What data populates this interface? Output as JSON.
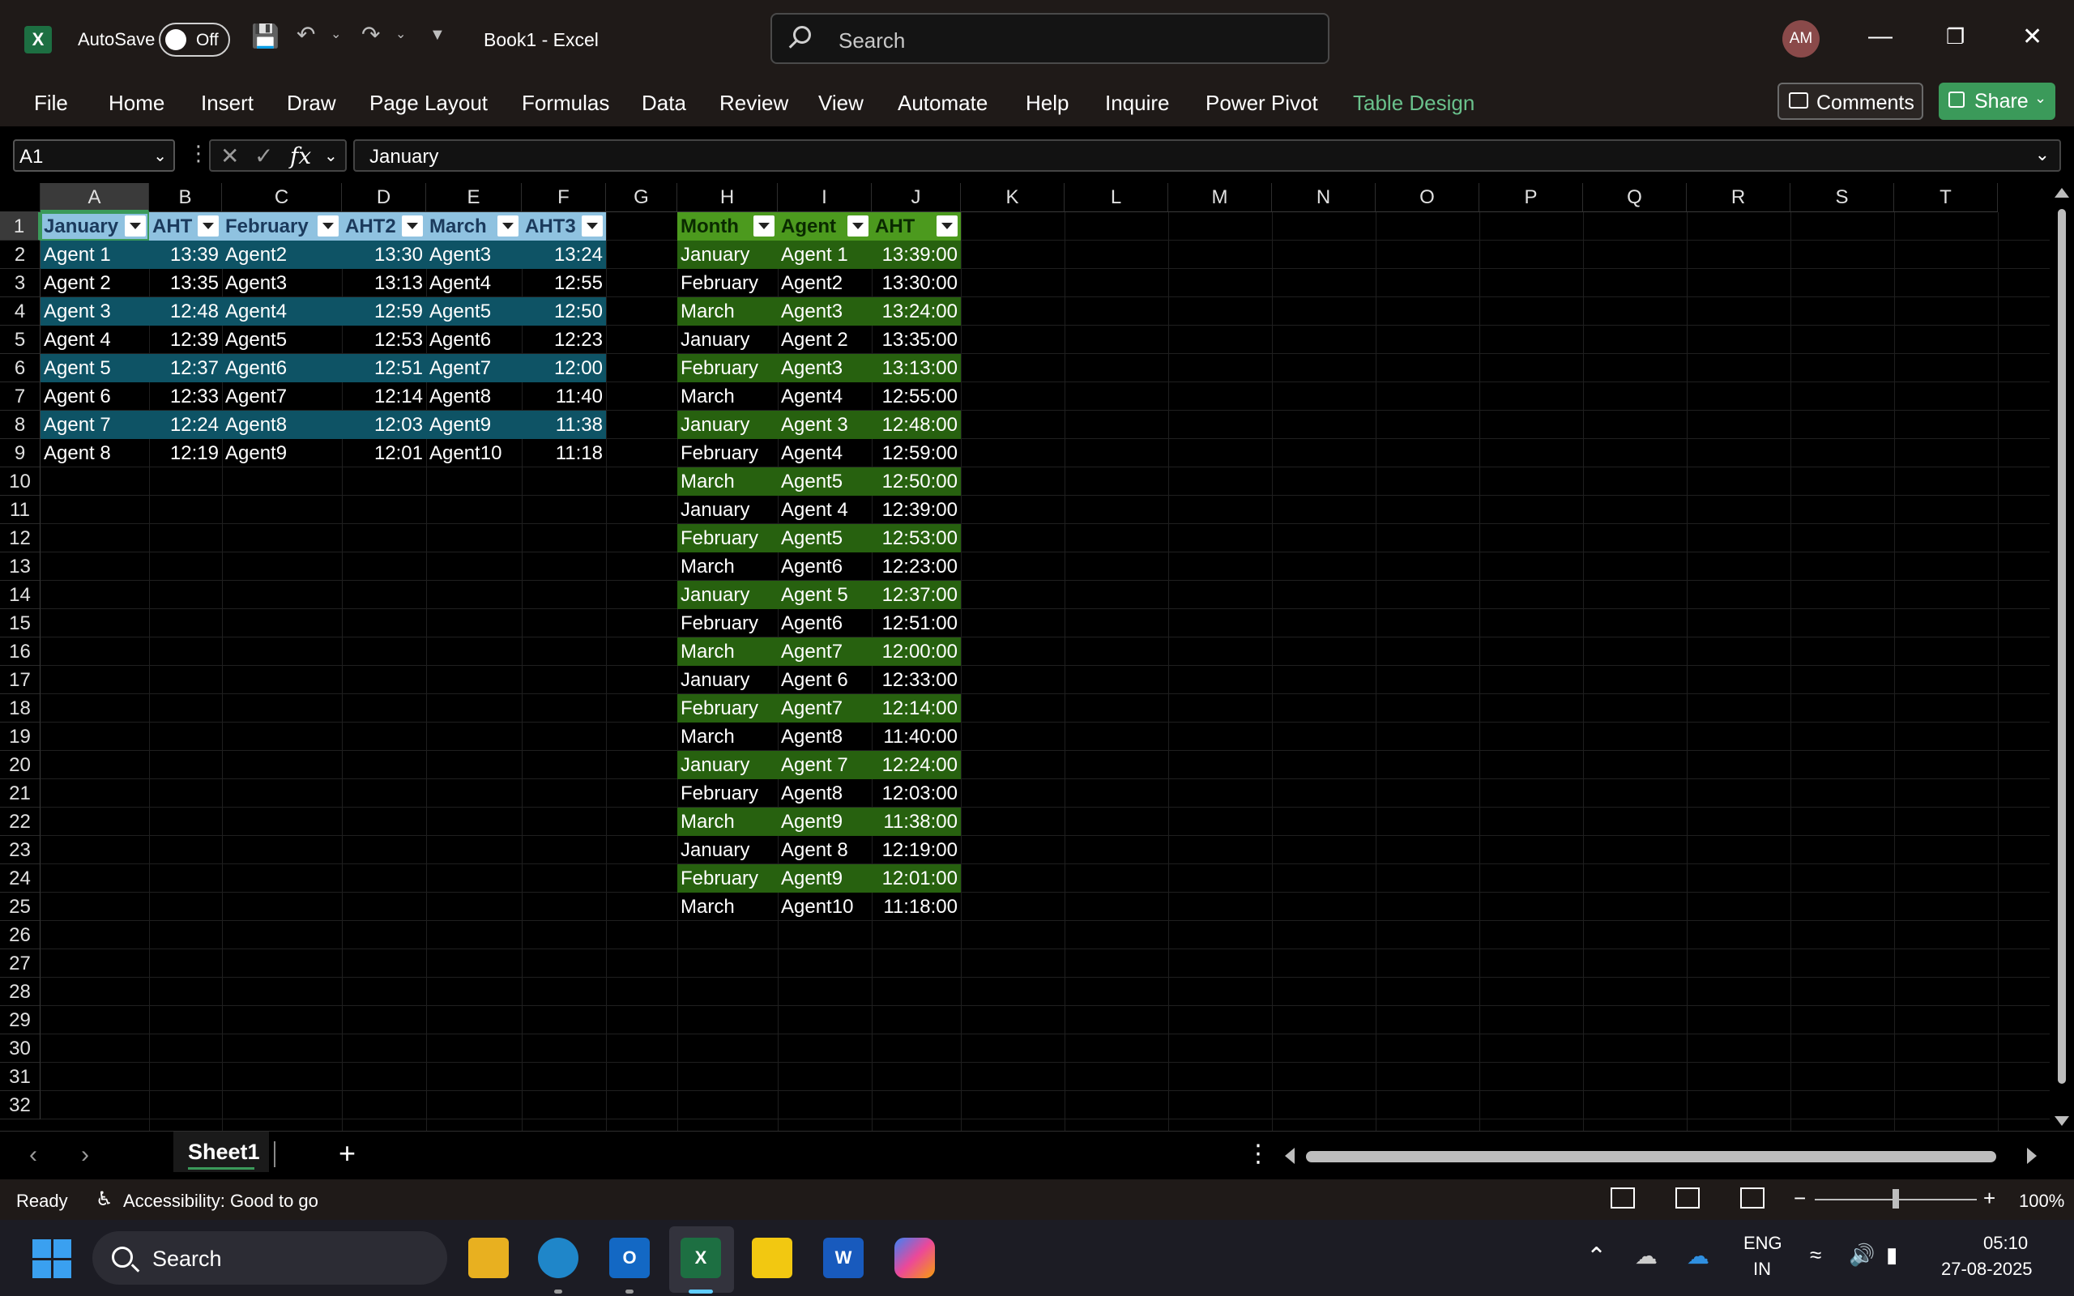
{
  "titlebar": {
    "autosave_label": "AutoSave",
    "autosave_state": "Off",
    "doc_title": "Book1  -  Excel",
    "search_placeholder": "Search",
    "avatar_initials": "AM"
  },
  "ribbon": {
    "tabs": [
      "File",
      "Home",
      "Insert",
      "Draw",
      "Page Layout",
      "Formulas",
      "Data",
      "Review",
      "View",
      "Automate",
      "Help",
      "Inquire",
      "Power Pivot",
      "Table Design"
    ],
    "active_tab": "Table Design",
    "comments_label": "Comments",
    "share_label": "Share"
  },
  "formula_bar": {
    "name_box": "A1",
    "fx_label": "fx",
    "formula_value": "January"
  },
  "columns": [
    "A",
    "B",
    "C",
    "D",
    "E",
    "F",
    "G",
    "H",
    "I",
    "J",
    "K",
    "L",
    "M",
    "N",
    "O",
    "P",
    "Q",
    "R",
    "S",
    "T"
  ],
  "rows": [
    "1",
    "2",
    "3",
    "4",
    "5",
    "6",
    "7",
    "8",
    "9",
    "10",
    "11",
    "12",
    "13",
    "14",
    "15",
    "16",
    "17",
    "18",
    "19",
    "20",
    "21",
    "22",
    "23",
    "24",
    "25",
    "26",
    "27",
    "28",
    "29",
    "30",
    "31",
    "32"
  ],
  "table1": {
    "headers": [
      "January",
      "AHT",
      "February",
      "AHT2",
      "March",
      "AHT3"
    ],
    "rows": [
      [
        "Agent 1",
        "13:39",
        "Agent2",
        "13:30",
        "Agent3",
        "13:24"
      ],
      [
        "Agent 2",
        "13:35",
        "Agent3",
        "13:13",
        "Agent4",
        "12:55"
      ],
      [
        "Agent 3",
        "12:48",
        "Agent4",
        "12:59",
        "Agent5",
        "12:50"
      ],
      [
        "Agent 4",
        "12:39",
        "Agent5",
        "12:53",
        "Agent6",
        "12:23"
      ],
      [
        "Agent 5",
        "12:37",
        "Agent6",
        "12:51",
        "Agent7",
        "12:00"
      ],
      [
        "Agent 6",
        "12:33",
        "Agent7",
        "12:14",
        "Agent8",
        "11:40"
      ],
      [
        "Agent 7",
        "12:24",
        "Agent8",
        "12:03",
        "Agent9",
        "11:38"
      ],
      [
        "Agent 8",
        "12:19",
        "Agent9",
        "12:01",
        "Agent10",
        "11:18"
      ]
    ]
  },
  "table2": {
    "headers": [
      "Month",
      "Agent",
      "AHT"
    ],
    "rows": [
      [
        "January",
        "Agent 1",
        "13:39:00"
      ],
      [
        "February",
        "Agent2",
        "13:30:00"
      ],
      [
        "March",
        "Agent3",
        "13:24:00"
      ],
      [
        "January",
        "Agent 2",
        "13:35:00"
      ],
      [
        "February",
        "Agent3",
        "13:13:00"
      ],
      [
        "March",
        "Agent4",
        "12:55:00"
      ],
      [
        "January",
        "Agent 3",
        "12:48:00"
      ],
      [
        "February",
        "Agent4",
        "12:59:00"
      ],
      [
        "March",
        "Agent5",
        "12:50:00"
      ],
      [
        "January",
        "Agent 4",
        "12:39:00"
      ],
      [
        "February",
        "Agent5",
        "12:53:00"
      ],
      [
        "March",
        "Agent6",
        "12:23:00"
      ],
      [
        "January",
        "Agent 5",
        "12:37:00"
      ],
      [
        "February",
        "Agent6",
        "12:51:00"
      ],
      [
        "March",
        "Agent7",
        "12:00:00"
      ],
      [
        "January",
        "Agent 6",
        "12:33:00"
      ],
      [
        "February",
        "Agent7",
        "12:14:00"
      ],
      [
        "March",
        "Agent8",
        "11:40:00"
      ],
      [
        "January",
        "Agent 7",
        "12:24:00"
      ],
      [
        "February",
        "Agent8",
        "12:03:00"
      ],
      [
        "March",
        "Agent9",
        "11:38:00"
      ],
      [
        "January",
        "Agent 8",
        "12:19:00"
      ],
      [
        "February",
        "Agent9",
        "12:01:00"
      ],
      [
        "March",
        "Agent10",
        "11:18:00"
      ]
    ]
  },
  "sheets": {
    "active": "Sheet1"
  },
  "status": {
    "ready": "Ready",
    "accessibility": "Accessibility: Good to go",
    "zoom": "100%"
  },
  "taskbar": {
    "search_label": "Search",
    "lang_top": "ENG",
    "lang_bottom": "IN",
    "time": "05:10",
    "date": "27-08-2025"
  },
  "colors": {
    "table1_band": "#0e5365",
    "table1_header": "#8fc2e0",
    "table2_band": "#27610f",
    "table2_header": "#4c9a1e",
    "accent": "#3b9a5a"
  }
}
